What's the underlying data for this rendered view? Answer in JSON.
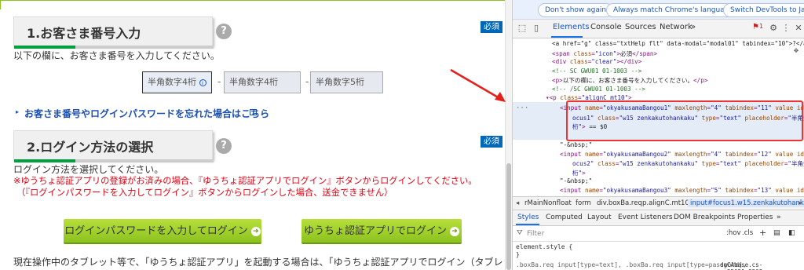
{
  "section1": {
    "title": "1.お客さま番号入力",
    "help": "?",
    "required": "必須",
    "instruction": "以下の欄に、お客さま番号を入力してください。",
    "fields": [
      {
        "placeholder": "半角数字4桁"
      },
      {
        "placeholder": "半角数字4桁"
      },
      {
        "placeholder": "半角数字5桁"
      }
    ],
    "separator": "-",
    "forgot_link": "お客さま番号やログインパスワードを忘れた場合はこちら"
  },
  "section2": {
    "title": "2.ログイン方法の選択",
    "help": "?",
    "required": "必須",
    "instruction": "ログイン方法を選択してください。",
    "note1": "※ゆうちょ認証アプリの登録がお済みの場合、『ゆうちょ認証アプリでログイン』ボタンからログインしてください。",
    "note2": "（『ログインパスワードを入力してログイン』ボタンからログインした場合、送金できません）",
    "button_password": "ログインパスワードを入力してログイン",
    "button_app": "ゆうちょ認証アプリでログイン",
    "bottom_text": "現在操作中のタブレット等で、「ゆうちょ認証アプリ」を起動する場合は、「ゆうちょ認証アプリでログイン（タブレット等で"
  },
  "devtools": {
    "infobar": {
      "dont_show": "Don't show again",
      "match_lang": "Always match Chrome's language",
      "switch_lang": "Switch DevTools to Japan"
    },
    "tabs": [
      "Elements",
      "Console",
      "Sources",
      "Network"
    ],
    "more_tabs": "»",
    "issues_count": "1",
    "dom_lines": [
      {
        "indent": 50,
        "html": "<span class=\"tx\">&lt;a href=\"g\" class=\"txtHelp flt\" data-modal=\"modal01\" tabindex=\"10\"&gt;?&lt;/a&gt;</span>"
      },
      {
        "indent": 50,
        "html": "&lt;span <span class=\"an\">class</span>=<span class=\"av\">\"icon\"</span>&gt;<span class=\"tx\">必須</span>&lt;/span&gt;"
      },
      {
        "indent": 50,
        "html": "&lt;div <span class=\"an\">class</span>=<span class=\"av\">\"clear\"</span>&gt;&lt;/div&gt;"
      },
      {
        "indent": 50,
        "html": "<span class=\"cm\">&lt;!-- SC GWU01 01-1003 --&gt;</span>"
      },
      {
        "indent": 50,
        "html": "&lt;p&gt;<span class=\"tx\">以下の欄に、お客さま番号を入力してください。</span>&lt;/p&gt;"
      },
      {
        "indent": 50,
        "html": "<span class=\"cm\">&lt;!-- /SC GWU01 01-1003 --&gt;</span>"
      },
      {
        "indent": 42,
        "html": "▾&lt;p <span class=\"an\">class</span>=<span class=\"av\">\"alignC mt10\"</span>&gt;"
      }
    ],
    "selected_lines": [
      "&lt;input <span class=\"an\">name</span>=<span class=\"av\">\"okyakusamaBangou1\"</span> <span class=\"an\">maxlength</span>=<span class=\"av\">\"4\"</span> <span class=\"an\">tabindex</span>=<span class=\"av\">\"11\"</span> <span class=\"an\">value id</span>=<span class=\"av\">\"f</span>",
      "<span class=\"av\">ocus1\"</span> <span class=\"an\">class</span>=<span class=\"av\">\"w15 zenkakutohankaku\"</span> <span class=\"an\">type</span>=<span class=\"av\">\"text\"</span> <span class=\"an\">placeholder</span>=<span class=\"av\">\"半角数字4</span>",
      "<span class=\"av\">桁\"</span>&gt; <span class=\"tx\">== $0</span>"
    ],
    "after_lines": [
      {
        "indent": 60,
        "html": "<span class=\"tx\">\"-&amp;nbsp;\"</span>"
      },
      {
        "indent": 60,
        "html": "&lt;input <span class=\"an\">name</span>=<span class=\"av\">\"okyakusamaBangou2\"</span> <span class=\"an\">maxlength</span>=<span class=\"av\">\"4\"</span> <span class=\"an\">tabindex</span>=<span class=\"av\">\"12\"</span> <span class=\"an\">value id</span>=<span class=\"av\">\"f</span>"
      },
      {
        "indent": 76,
        "html": "<span class=\"av\">ocus2\"</span> <span class=\"an\">class</span>=<span class=\"av\">\"w15 zenkakutohankaku\"</span> <span class=\"an\">type</span>=<span class=\"av\">\"text\"</span> <span class=\"an\">placeholder</span>=<span class=\"av\">\"半角数字4</span>"
      },
      {
        "indent": 76,
        "html": "<span class=\"av\">桁\"</span>&gt;"
      },
      {
        "indent": 60,
        "html": "<span class=\"tx\">\"-&amp;nbsp;\"</span>"
      },
      {
        "indent": 60,
        "html": "&lt;input <span class=\"an\">name</span>=<span class=\"av\">\"okyakusamaBangou3\"</span> <span class=\"an\">maxlength</span>=<span class=\"av\">\"5\"</span> <span class=\"an\">tabindex</span>=<span class=\"av\">\"13\"</span> <span class=\"an\">value id</span>=<span class=\"av\">\"f</span>"
      },
      {
        "indent": 76,
        "html": "<span class=\"av\">ocus3 off\"</span> <span class=\"an\">class</span>=<span class=\"av\">\"w15 zenkakutohankaku\"</span> <span class=\"an\">type</span>=<span class=\"av\">\"text\"</span> <span class=\"an\">placeholder</span>=<span class=\"av\">\"半角数</span>"
      }
    ],
    "breadcrumbs": [
      "rMainNonfloat",
      "form",
      "div.boxBa.req",
      "p.alignC.mt10",
      "input#focus1.w15.zenkakutohankaku"
    ],
    "subtabs": [
      "Styles",
      "Computed",
      "Layout",
      "Event Listeners",
      "DOM Breakpoints",
      "Properties"
    ],
    "filter_placeholder": "Filter",
    "filter_tools": [
      ":hov",
      ".cls",
      "+"
    ],
    "styles_lines": [
      "element.style {",
      "}",
      ".boxBa.req input[type=text], .boxBa.req input[type=password],"
    ],
    "styles_source": "dgCAbase.cs-~=25051:3208"
  }
}
